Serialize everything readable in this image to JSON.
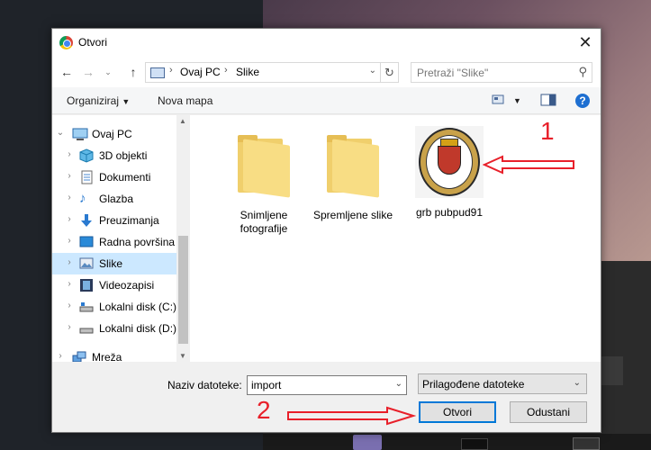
{
  "window": {
    "title": "Otvori"
  },
  "address": {
    "crumbs": [
      "Ovaj PC",
      "Slike"
    ]
  },
  "search": {
    "placeholder": "Pretraži \"Slike\""
  },
  "toolbar": {
    "organize": "Organiziraj",
    "new_folder": "Nova mapa"
  },
  "nav": {
    "items": [
      {
        "label": "Ovaj PC",
        "icon": "computer-icon",
        "expanded": true
      },
      {
        "label": "3D objekti",
        "icon": "cube-icon"
      },
      {
        "label": "Dokumenti",
        "icon": "document-icon"
      },
      {
        "label": "Glazba",
        "icon": "music-icon"
      },
      {
        "label": "Preuzimanja",
        "icon": "download-icon"
      },
      {
        "label": "Radna površina",
        "icon": "desktop-icon"
      },
      {
        "label": "Slike",
        "icon": "pictures-icon",
        "selected": true
      },
      {
        "label": "Videozapisi",
        "icon": "video-icon"
      },
      {
        "label": "Lokalni disk (C:)",
        "icon": "drive-icon"
      },
      {
        "label": "Lokalni disk (D:)",
        "icon": "drive-icon"
      },
      {
        "label": "Mreža",
        "icon": "network-icon"
      }
    ]
  },
  "files": [
    {
      "label": "Snimljene fotografije",
      "type": "folder"
    },
    {
      "label": "Spremljene slike",
      "type": "folder"
    },
    {
      "label": "grb pubpud91",
      "type": "image"
    }
  ],
  "bottom": {
    "filename_label": "Naziv datoteke:",
    "filename_value": "import",
    "filter_value": "Prilagođene datoteke",
    "open_label": "Otvori",
    "cancel_label": "Odustani"
  },
  "annotations": {
    "one": "1",
    "two": "2"
  },
  "colors": {
    "annotation_red": "#e8202a",
    "selection": "#cce8ff",
    "primary_border": "#0078d7"
  }
}
